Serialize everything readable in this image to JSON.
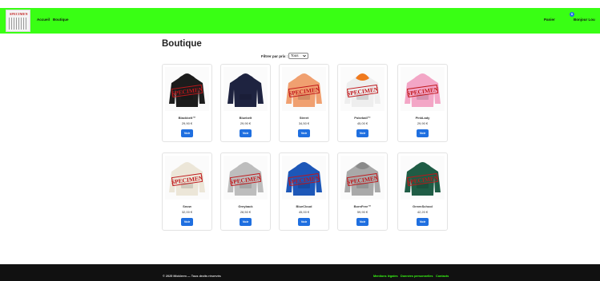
{
  "header": {
    "logo_stamp": "SPECIMEN",
    "nav": [
      "Accueil",
      "Boutique"
    ],
    "cart_label": "Panier",
    "cart_count": "0",
    "greeting": "Bonjour Lou"
  },
  "page": {
    "title": "Boutique",
    "filter_label": "Filtrer par prix :",
    "filter_value": "Tous"
  },
  "stamp_text": "SPECIMEN",
  "products": [
    {
      "name": "Blackbelt™",
      "price": "29,90 €",
      "button": "Voir",
      "color": "#1c1c1c",
      "hood": "#1c1c1c"
    },
    {
      "name": "Bluebelt",
      "price": "29,90 €",
      "button": "Voir",
      "color": "#1e2340",
      "hood": "#1e2340"
    },
    {
      "name": "Street",
      "price": "34,50 €",
      "button": "Voir",
      "color": "#f0a070",
      "hood": "#f0a070"
    },
    {
      "name": "Pokeball™",
      "price": "45,00 €",
      "button": "Voir",
      "color": "#eeeeee",
      "hood": "#f07a1e"
    },
    {
      "name": "PinkLady",
      "price": "29,90 €",
      "button": "Voir",
      "color": "#f3a6c6",
      "hood": "#f3a6c6"
    },
    {
      "name": "Snow",
      "price": "32,00 €",
      "button": "Voir",
      "color": "#ece6d8",
      "hood": "#ece6d8"
    },
    {
      "name": "Greyback",
      "price": "28,50 €",
      "button": "Voir",
      "color": "#bdbdbd",
      "hood": "#bdbdbd"
    },
    {
      "name": "BlueCloud",
      "price": "45,00 €",
      "button": "Voir",
      "color": "#1d57b8",
      "hood": "#1d57b8"
    },
    {
      "name": "BornFree™",
      "price": "59,90 €",
      "button": "Voir",
      "color": "#a9a9a9",
      "hood": "#8a8a8a"
    },
    {
      "name": "GreenSchool",
      "price": "42,20 €",
      "button": "Voir",
      "color": "#1f5c45",
      "hood": "#1f5c45"
    }
  ],
  "footer": {
    "copyright": "© 2025 Micklerm — Tous droits réservés",
    "links": [
      "Mentions légales",
      "Données personnelles",
      "Contacts"
    ]
  }
}
